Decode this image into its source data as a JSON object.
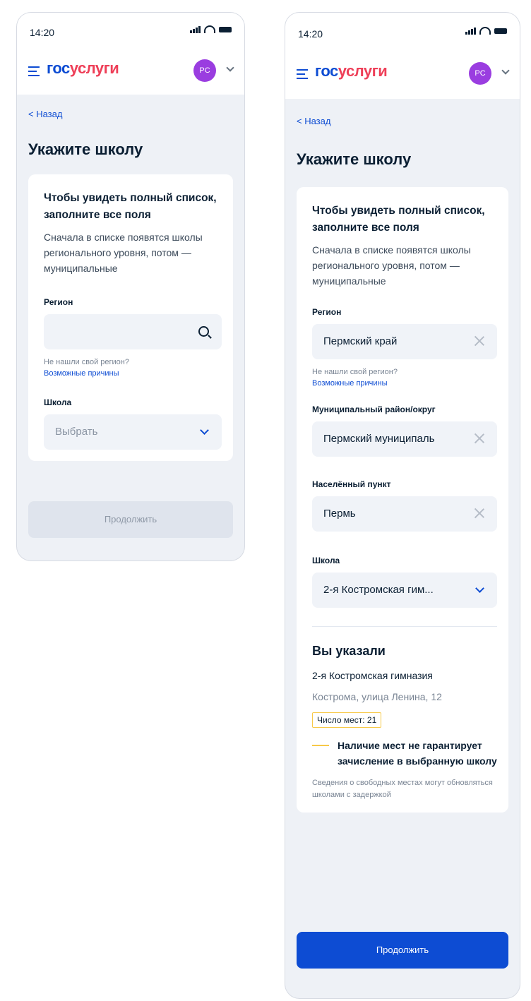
{
  "status": {
    "time": "14:20"
  },
  "header": {
    "logo_part1": "гос",
    "logo_part2": "услуги",
    "avatar": "PC"
  },
  "page": {
    "back": "< Назад",
    "title": "Укажите школу",
    "card_title": "Чтобы увидеть полный список, заполните все поля",
    "card_sub": "Сначала в списке появятся школы регионального уровня, потом — муниципальные"
  },
  "form": {
    "region_label": "Регион",
    "region_value": "Пермский край",
    "region_hint": "Не нашли свой регион?",
    "region_link": "Возможные причины",
    "municipal_label": "Муниципальный район/округ",
    "municipal_value": "Пермский муниципаль",
    "locality_label": "Населённый пункт",
    "locality_value": "Пермь",
    "school_label": "Школа",
    "school_placeholder": "Выбрать",
    "school_value": "2-я Костромская гим..."
  },
  "summary": {
    "title": "Вы указали",
    "school": "2-я Костромская гимназия",
    "address": "Кострома, улица Ленина, 12",
    "seats": "Число мест: 21",
    "warning": "Наличие мест не гарантирует зачисление в выбранную школу",
    "note": "Сведения о свободных местах могут обновляться школами с задержкой"
  },
  "button": {
    "continue": "Продолжить"
  },
  "colors": {
    "accent": "#0d4cd3",
    "logo_red": "#ee3f58",
    "avatar": "#9a3de0",
    "badge": "#f7c948"
  }
}
